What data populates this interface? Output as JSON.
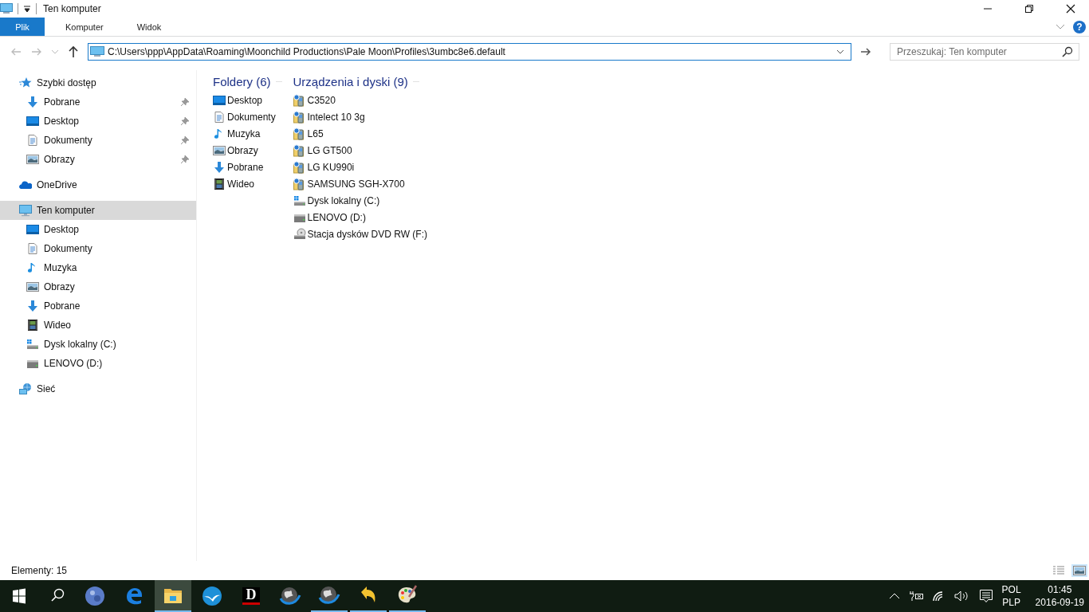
{
  "window": {
    "title": "Ten komputer"
  },
  "ribbon": {
    "tabs": [
      {
        "label": "Plik",
        "kind": "file"
      },
      {
        "label": "Komputer",
        "kind": "tab"
      },
      {
        "label": "Widok",
        "kind": "tab"
      }
    ],
    "help": "?"
  },
  "address_bar": {
    "path": "C:\\Users\\ppp\\AppData\\Roaming\\Moonchild Productions\\Pale Moon\\Profiles\\3umbc8e6.default"
  },
  "search": {
    "placeholder": "Przeszukaj: Ten komputer"
  },
  "sidebar": {
    "items": [
      {
        "label": "Szybki dostęp",
        "kind": "star",
        "selected": false,
        "children": [
          {
            "label": "Pobrane",
            "kind": "download",
            "pinned": true,
            "selected": false
          },
          {
            "label": "Desktop",
            "kind": "desktop",
            "pinned": true,
            "selected": false
          },
          {
            "label": "Dokumenty",
            "kind": "document",
            "pinned": true,
            "selected": false
          },
          {
            "label": "Obrazy",
            "kind": "picture",
            "pinned": true,
            "selected": false
          }
        ]
      },
      {
        "label": "OneDrive",
        "kind": "cloud",
        "selected": false
      },
      {
        "label": "Ten komputer",
        "kind": "computer",
        "selected": true,
        "children": [
          {
            "label": "Desktop",
            "kind": "desktop",
            "pinned": false,
            "selected": false
          },
          {
            "label": "Dokumenty",
            "kind": "document",
            "pinned": false,
            "selected": false
          },
          {
            "label": "Muzyka",
            "kind": "music",
            "pinned": false,
            "selected": false
          },
          {
            "label": "Obrazy",
            "kind": "picture",
            "pinned": false,
            "selected": false
          },
          {
            "label": "Pobrane",
            "kind": "download",
            "pinned": false,
            "selected": false
          },
          {
            "label": "Wideo",
            "kind": "video",
            "pinned": false,
            "selected": false
          },
          {
            "label": "Dysk lokalny (C:)",
            "kind": "drive-windows",
            "pinned": false,
            "selected": false
          },
          {
            "label": "LENOVO (D:)",
            "kind": "drive",
            "pinned": false,
            "selected": false
          }
        ]
      },
      {
        "label": "Sieć",
        "kind": "network",
        "selected": false
      }
    ]
  },
  "groups": [
    {
      "title": "Foldery (6)",
      "items": [
        {
          "label": "Desktop",
          "kind": "desktop"
        },
        {
          "label": "Dokumenty",
          "kind": "document"
        },
        {
          "label": "Muzyka",
          "kind": "music"
        },
        {
          "label": "Obrazy",
          "kind": "picture"
        },
        {
          "label": "Pobrane",
          "kind": "download"
        },
        {
          "label": "Wideo",
          "kind": "video"
        }
      ]
    },
    {
      "title": "Urządzenia i dyski (9)",
      "items": [
        {
          "label": "C3520",
          "kind": "phone"
        },
        {
          "label": "Intelect 10 3g",
          "kind": "phone"
        },
        {
          "label": "L65",
          "kind": "phone"
        },
        {
          "label": "LG GT500",
          "kind": "phone"
        },
        {
          "label": "LG KU990i",
          "kind": "phone"
        },
        {
          "label": "SAMSUNG SGH-X700",
          "kind": "phone"
        },
        {
          "label": "Dysk lokalny (C:)",
          "kind": "drive-windows"
        },
        {
          "label": "LENOVO (D:)",
          "kind": "drive"
        },
        {
          "label": "Stacja dysków DVD RW (F:)",
          "kind": "dvd"
        }
      ]
    }
  ],
  "status_bar": {
    "count": "Elementy: 15",
    "views": [
      {
        "kind": "details",
        "selected": false
      },
      {
        "kind": "large-icons",
        "selected": true
      }
    ]
  },
  "taskbar": {
    "apps": [
      {
        "kind": "moon",
        "running": false,
        "selected": false
      },
      {
        "kind": "edge",
        "running": false,
        "selected": false
      },
      {
        "kind": "explorer",
        "running": true,
        "selected": true
      },
      {
        "kind": "bird",
        "running": false,
        "selected": false
      },
      {
        "kind": "letter",
        "glyph": "D",
        "running": false,
        "selected": false
      },
      {
        "kind": "globe",
        "running": false,
        "selected": false
      },
      {
        "kind": "globe",
        "running": true,
        "selected": false
      },
      {
        "kind": "undo",
        "running": true,
        "selected": false
      },
      {
        "kind": "palette",
        "running": true,
        "selected": false
      }
    ],
    "tray": {
      "language": "POL",
      "layout": "PLP",
      "time": "01:45",
      "date": "2016-09-19"
    }
  }
}
